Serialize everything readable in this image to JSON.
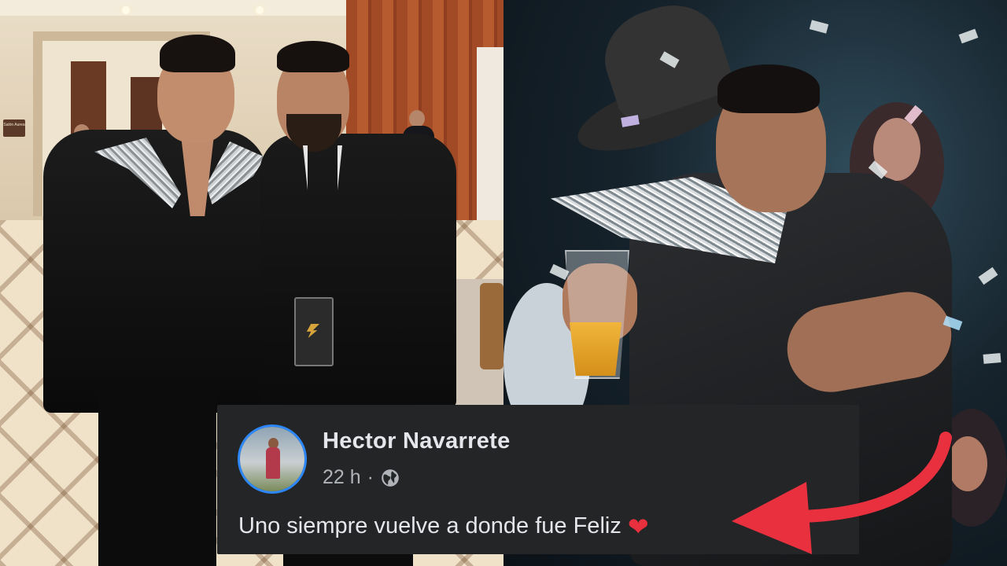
{
  "left_photo": {
    "sign_text": "Salón Aurea"
  },
  "comment": {
    "author": "Hector Navarrete",
    "time": "22 h",
    "separator": "·",
    "audience_icon": "globe-icon",
    "text": "Uno siempre vuelve a donde fue Feliz",
    "emoji_icon": "heart-icon",
    "emoji_char": "❤"
  },
  "colors": {
    "card_bg": "#242526",
    "name_color": "#e4e6eb",
    "meta_color": "#b0b3b8",
    "avatar_ring": "#2d88ff",
    "arrow_red": "#e8303f"
  }
}
